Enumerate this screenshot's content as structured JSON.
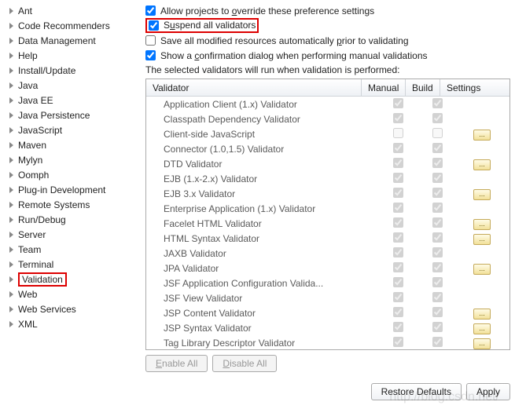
{
  "sidebar": {
    "items": [
      {
        "label": "Ant",
        "selected": false
      },
      {
        "label": "Code Recommenders"
      },
      {
        "label": "Data Management"
      },
      {
        "label": "Help"
      },
      {
        "label": "Install/Update"
      },
      {
        "label": "Java"
      },
      {
        "label": "Java EE"
      },
      {
        "label": "Java Persistence"
      },
      {
        "label": "JavaScript"
      },
      {
        "label": "Maven"
      },
      {
        "label": "Mylyn"
      },
      {
        "label": "Oomph"
      },
      {
        "label": "Plug-in Development"
      },
      {
        "label": "Remote Systems"
      },
      {
        "label": "Run/Debug"
      },
      {
        "label": "Server"
      },
      {
        "label": "Team"
      },
      {
        "label": "Terminal"
      },
      {
        "label": "Validation",
        "highlighted": true
      },
      {
        "label": "Web"
      },
      {
        "label": "Web Services"
      },
      {
        "label": "XML"
      }
    ]
  },
  "options": {
    "allow_override": {
      "label_pre": "Allow projects to ",
      "mnemonic": "o",
      "label_post": "verride these preference settings",
      "checked": true
    },
    "suspend": {
      "label_pre": "S",
      "mnemonic": "u",
      "label_post": "spend all validators",
      "checked": true,
      "highlighted": true
    },
    "save_modified": {
      "label_pre": "Save all modified resources automatically ",
      "mnemonic": "p",
      "label_post": "rior to validating",
      "checked": false
    },
    "confirm_dialog": {
      "label_pre": "Show a ",
      "mnemonic": "c",
      "label_post": "onfirmation dialog when performing manual validations",
      "checked": true
    },
    "description": "The selected validators will run when validation is performed:"
  },
  "table": {
    "headers": {
      "validator": "Validator",
      "manual": "Manual",
      "build": "Build",
      "settings": "Settings"
    },
    "rows": [
      {
        "name": "Application Client (1.x) Validator",
        "manual": true,
        "build": true,
        "settings": false
      },
      {
        "name": "Classpath Dependency Validator",
        "manual": true,
        "build": true,
        "settings": false
      },
      {
        "name": "Client-side JavaScript",
        "manual": false,
        "build": false,
        "settings": true
      },
      {
        "name": "Connector (1.0,1.5) Validator",
        "manual": true,
        "build": true,
        "settings": false
      },
      {
        "name": "DTD Validator",
        "manual": true,
        "build": true,
        "settings": true
      },
      {
        "name": "EJB (1.x-2.x) Validator",
        "manual": true,
        "build": true,
        "settings": false
      },
      {
        "name": "EJB 3.x Validator",
        "manual": true,
        "build": true,
        "settings": true
      },
      {
        "name": "Enterprise Application (1.x) Validator",
        "manual": true,
        "build": true,
        "settings": false
      },
      {
        "name": "Facelet HTML Validator",
        "manual": true,
        "build": true,
        "settings": true
      },
      {
        "name": "HTML Syntax Validator",
        "manual": true,
        "build": true,
        "settings": true
      },
      {
        "name": "JAXB Validator",
        "manual": true,
        "build": true,
        "settings": false
      },
      {
        "name": "JPA Validator",
        "manual": true,
        "build": true,
        "settings": true
      },
      {
        "name": "JSF Application Configuration Valida...",
        "manual": true,
        "build": true,
        "settings": false
      },
      {
        "name": "JSF View Validator",
        "manual": true,
        "build": true,
        "settings": false
      },
      {
        "name": "JSP Content Validator",
        "manual": true,
        "build": true,
        "settings": true
      },
      {
        "name": "JSP Syntax Validator",
        "manual": true,
        "build": true,
        "settings": true
      },
      {
        "name": "Tag Library Descriptor Validator",
        "manual": true,
        "build": true,
        "settings": true
      }
    ]
  },
  "buttons": {
    "enable_all": "Enable All",
    "disable_all": "Disable All",
    "restore_defaults": "Restore Defaults",
    "apply": "Apply"
  },
  "watermark": "http://blog.csdn.net/"
}
